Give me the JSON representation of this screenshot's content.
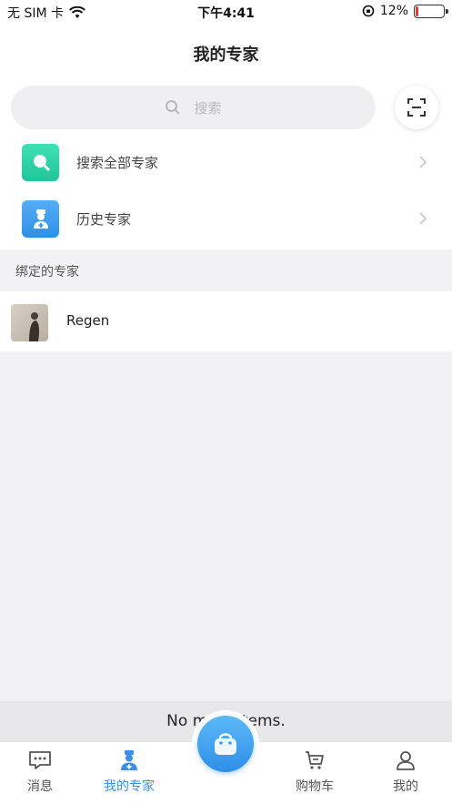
{
  "status_bar": {
    "carrier": "无 SIM 卡",
    "time": "下午4:41",
    "battery_percent": "12%",
    "battery_level": 0.12
  },
  "nav": {
    "title": "我的专家"
  },
  "search": {
    "placeholder": "搜索"
  },
  "menu": [
    {
      "label": "搜索全部专家",
      "icon": "search-icon",
      "color": "#2ed3a8"
    },
    {
      "label": "历史专家",
      "icon": "doctor-icon",
      "color": "#3d9cf0"
    }
  ],
  "section": {
    "title": "绑定的专家"
  },
  "experts": [
    {
      "name": "Regen"
    }
  ],
  "footer": {
    "text": "No more items."
  },
  "tabs": [
    {
      "label": "消息",
      "icon": "message-icon"
    },
    {
      "label": "我的专家",
      "icon": "expert-icon",
      "active": true
    },
    {
      "label": "购物车",
      "icon": "cart-icon"
    },
    {
      "label": "我的",
      "icon": "profile-icon"
    }
  ],
  "colors": {
    "accent": "#3a8ee6",
    "battery_low": "#e53935"
  }
}
